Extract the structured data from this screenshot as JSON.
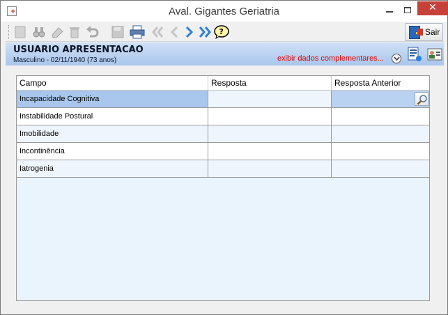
{
  "window": {
    "title": "Aval. Gigantes Geriatria",
    "close_glyph": "✕"
  },
  "toolbar": {
    "buttons": [
      {
        "name": "new-record-icon",
        "enabled": false
      },
      {
        "name": "search-binoculars-icon",
        "enabled": false
      },
      {
        "name": "eraser-icon",
        "enabled": false
      },
      {
        "name": "delete-trash-icon",
        "enabled": false
      },
      {
        "name": "undo-icon",
        "enabled": false
      },
      {
        "name": "save-floppy-icon",
        "enabled": false
      },
      {
        "name": "print-icon",
        "enabled": true
      },
      {
        "name": "first-record-icon",
        "enabled": false
      },
      {
        "name": "previous-record-icon",
        "enabled": false
      },
      {
        "name": "next-record-icon",
        "enabled": true
      },
      {
        "name": "last-record-icon",
        "enabled": true
      },
      {
        "name": "help-icon",
        "enabled": true
      }
    ],
    "exit_label": "Sair"
  },
  "patient": {
    "name": "USUARIO APRESENTACAO",
    "info": "Masculino - 02/11/1940 (73 anos)",
    "extra_link": "exibir dados complementares..."
  },
  "grid": {
    "columns": [
      "Campo",
      "Resposta",
      "Resposta Anterior"
    ],
    "rows": [
      {
        "campo": "Incapacidade Cognitiva",
        "resposta": "",
        "anterior": ""
      },
      {
        "campo": "Instabilidade Postural",
        "resposta": "",
        "anterior": ""
      },
      {
        "campo": "Imobilidade",
        "resposta": "",
        "anterior": ""
      },
      {
        "campo": "Incontinência",
        "resposta": "",
        "anterior": ""
      },
      {
        "campo": "Iatrogenia",
        "resposta": "",
        "anterior": ""
      }
    ],
    "selected_row": 0
  },
  "colors": {
    "header_gradient_top": "#cfe0f6",
    "header_gradient_bottom": "#a9c6ec",
    "selected_row": "#a9c6ec",
    "link_red": "#e00000",
    "close_red": "#c7413b"
  }
}
